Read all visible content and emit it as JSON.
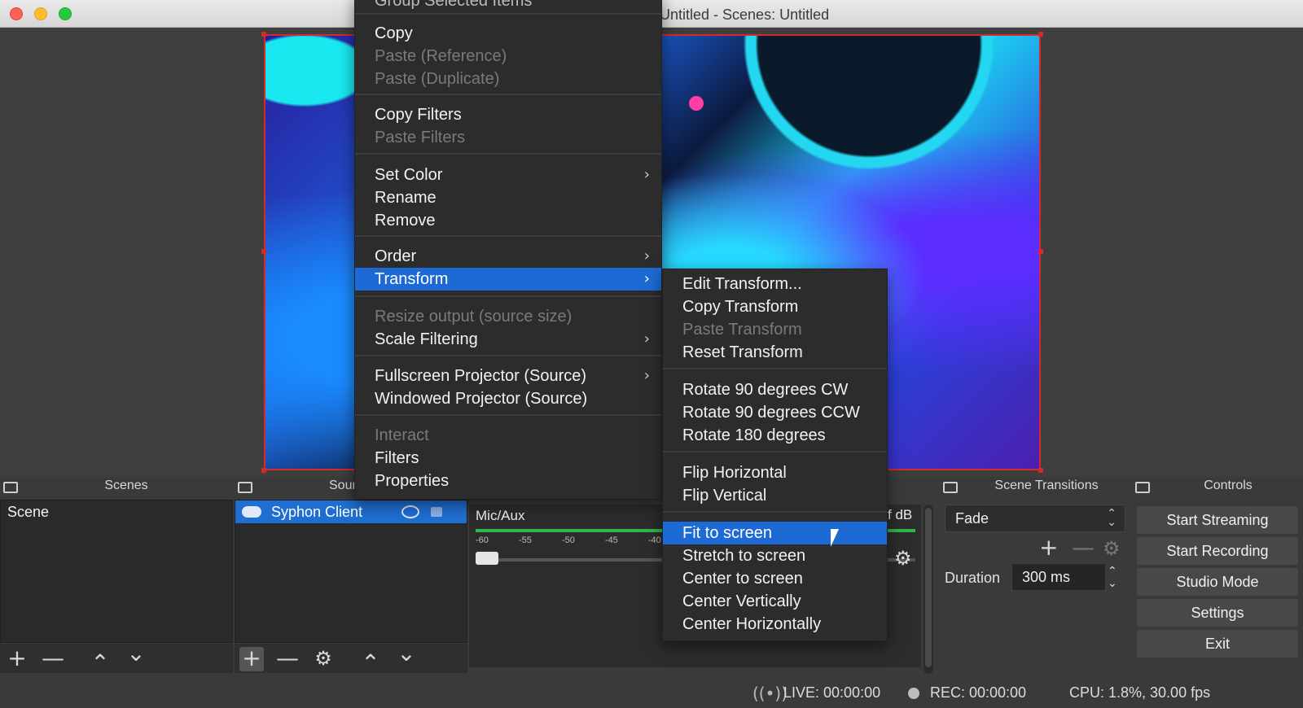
{
  "window": {
    "title": "Untitled - Scenes: Untitled"
  },
  "docks": {
    "scenes": "Scenes",
    "sources": "Sources",
    "scene_transitions": "Scene Transitions",
    "controls": "Controls"
  },
  "scenes": {
    "items": [
      "Scene"
    ]
  },
  "sources": {
    "items": [
      {
        "name": "Syphon Client",
        "selected": true
      }
    ]
  },
  "mixer": {
    "track": "Mic/Aux",
    "ticks": [
      "-60",
      "-55",
      "-50",
      "-45",
      "-40"
    ],
    "db_readout": "f dB",
    "volume_level": 0.0
  },
  "transitions": {
    "selected": "Fade",
    "duration_label": "Duration",
    "duration_value": "300 ms"
  },
  "controls": {
    "start_streaming": "Start Streaming",
    "start_recording": "Start Recording",
    "studio_mode": "Studio Mode",
    "settings": "Settings",
    "exit": "Exit"
  },
  "status": {
    "live": "LIVE: 00:00:00",
    "rec": "REC: 00:00:00",
    "cpu": "CPU: 1.8%, 30.00 fps"
  },
  "context_menu": {
    "top_cut": "Group Selected Items",
    "copy": "Copy",
    "paste_reference": "Paste (Reference)",
    "paste_duplicate": "Paste (Duplicate)",
    "copy_filters": "Copy Filters",
    "paste_filters": "Paste Filters",
    "set_color": "Set Color",
    "rename": "Rename",
    "remove": "Remove",
    "order": "Order",
    "transform": "Transform",
    "resize_output": "Resize output (source size)",
    "scale_filtering": "Scale Filtering",
    "fullscreen_projector": "Fullscreen Projector (Source)",
    "windowed_projector": "Windowed Projector (Source)",
    "interact": "Interact",
    "filters": "Filters",
    "properties": "Properties"
  },
  "transform_menu": {
    "edit_transform": "Edit Transform...",
    "copy_transform": "Copy Transform",
    "paste_transform": "Paste Transform",
    "reset_transform": "Reset Transform",
    "rotate_cw": "Rotate 90 degrees CW",
    "rotate_ccw": "Rotate 90 degrees CCW",
    "rotate_180": "Rotate 180 degrees",
    "flip_horizontal": "Flip Horizontal",
    "flip_vertical": "Flip Vertical",
    "fit_to_screen": "Fit to screen",
    "stretch_to_screen": "Stretch to screen",
    "center_to_screen": "Center to screen",
    "center_vertically": "Center Vertically",
    "center_horizontally": "Center Horizontally"
  },
  "icons": {
    "add": "+",
    "remove": "—",
    "up": "⌃",
    "down": "⌄",
    "gear": "⚙",
    "submenu": "›"
  },
  "colors": {
    "accent": "#1d6ad4",
    "selection_border": "#d42a2a",
    "meter_green": "#2fb54a"
  }
}
